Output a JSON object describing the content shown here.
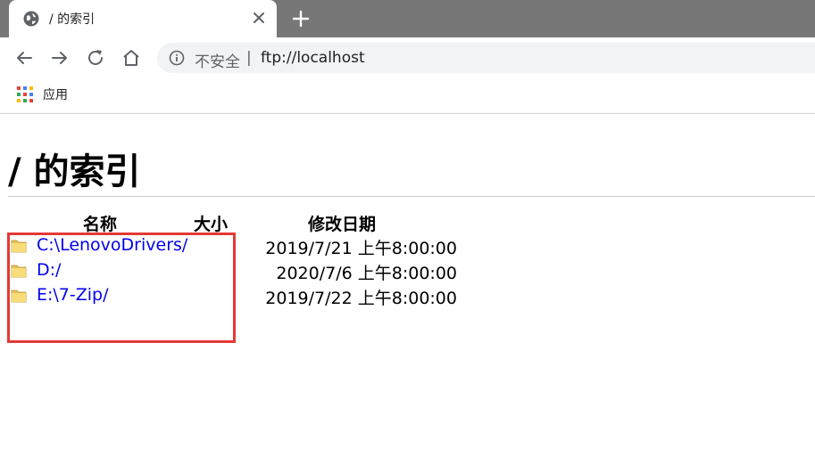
{
  "browser": {
    "tab_title": "/ 的索引",
    "security_label": "不安全",
    "separator": "|",
    "url": "ftp://localhost",
    "bookmarks": [
      {
        "label": "应用",
        "icon": "apps-grid-icon"
      }
    ]
  },
  "page": {
    "title": "/ 的索引",
    "columns": {
      "name": "名称",
      "size": "大小",
      "modified": "修改日期"
    },
    "entries": [
      {
        "name": "C:\\LenovoDrivers/",
        "size": "",
        "modified": "2019/7/21 上午8:00:00",
        "icon": "folder-icon"
      },
      {
        "name": "D:/",
        "size": "",
        "modified": "2020/7/6 上午8:00:00",
        "icon": "folder-icon"
      },
      {
        "name": "E:\\7-Zip/",
        "size": "",
        "modified": "2019/7/22 上午8:00:00",
        "icon": "folder-icon"
      }
    ]
  },
  "colors": {
    "tabstrip": "#777777",
    "link": "#0000ee",
    "highlight": "#e53935"
  }
}
